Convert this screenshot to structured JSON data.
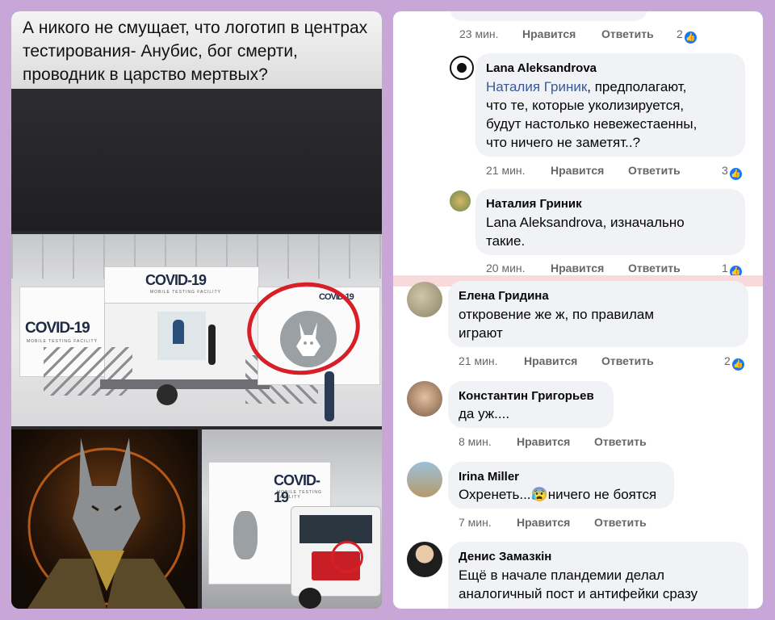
{
  "left": {
    "caption": "А никого не смущает, что логотип в центрах тестирования- Анубис, бог смерти, проводник в царство мертвых?",
    "logo_main": "COVID-19",
    "logo_sub": "MOBILE TESTING FACILITY"
  },
  "comments_top": [
    {
      "time": "23 мин.",
      "like_label": "Нравится",
      "reply_label": "Ответить",
      "reactions": "2"
    },
    {
      "author": "Lana  Aleksandrova",
      "mention": "Наталия Гриник",
      "text_lines": [
        ", предполагают,",
        "что те, которые уколизируется,",
        "будут настолько невежестаенны,",
        "что ничего не заметят..?"
      ],
      "time": "21 мин.",
      "like_label": "Нравится",
      "reply_label": "Ответить",
      "reactions": "3"
    },
    {
      "author": "Наталия Гриник",
      "text_lines": [
        "Lana  Aleksandrova, изначально",
        "такие."
      ],
      "time": "20 мин.",
      "like_label": "Нравится",
      "reply_label": "Ответить",
      "reactions": "1"
    }
  ],
  "comments_bottom": [
    {
      "author": "Елена Гридина",
      "text_lines": [
        "откровение же ж, по правилам",
        "играют"
      ],
      "time": "21 мин.",
      "like_label": "Нравится",
      "reply_label": "Ответить",
      "reactions": "2"
    },
    {
      "author": "Константин Григорьев",
      "text_lines": [
        "да уж...."
      ],
      "time": "8 мин.",
      "like_label": "Нравится",
      "reply_label": "Ответить"
    },
    {
      "author": "Irina Miller",
      "text_before": "Охренеть...",
      "emoji": "😰",
      "text_after": "ничего не боятся",
      "time": "7 мин.",
      "like_label": "Нравится",
      "reply_label": "Ответить"
    },
    {
      "author": "Денис Замазкін",
      "text_lines": [
        "Ещё в начале пландемии делал",
        "аналогичный пост и антифейки сразу"
      ]
    }
  ],
  "colors": {
    "page_border": "#c9a6d8",
    "accent_red": "#d81e26",
    "fb_blue": "#1877f2",
    "bubble": "#f0f2f5"
  },
  "icons": {
    "like": "thumbs-up-icon"
  }
}
